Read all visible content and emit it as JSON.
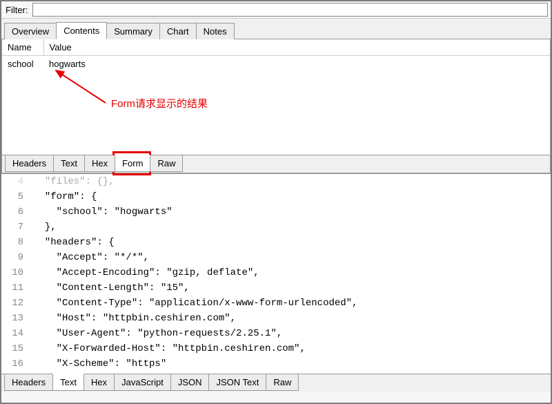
{
  "filter": {
    "label": "Filter:",
    "value": ""
  },
  "mainTabs": [
    "Overview",
    "Contents",
    "Summary",
    "Chart",
    "Notes"
  ],
  "mainActiveIndex": 1,
  "upper": {
    "headers": {
      "name": "Name",
      "value": "Value"
    },
    "rows": [
      {
        "name": "school",
        "value": "hogwarts"
      }
    ],
    "bottomTabs": [
      "Headers",
      "Text",
      "Hex",
      "Form",
      "Raw"
    ],
    "bottomActiveIndex": 3
  },
  "annotation": {
    "text": "Form请求显示的结果"
  },
  "lower": {
    "lines": [
      {
        "n": 4,
        "indent": 1,
        "text": "\"files\": {},",
        "dim": true
      },
      {
        "n": 5,
        "indent": 1,
        "text": "\"form\": {"
      },
      {
        "n": 6,
        "indent": 2,
        "text": "\"school\": \"hogwarts\""
      },
      {
        "n": 7,
        "indent": 1,
        "text": "},"
      },
      {
        "n": 8,
        "indent": 1,
        "text": "\"headers\": {"
      },
      {
        "n": 9,
        "indent": 2,
        "text": "\"Accept\": \"*/*\","
      },
      {
        "n": 10,
        "indent": 2,
        "text": "\"Accept-Encoding\": \"gzip, deflate\","
      },
      {
        "n": 11,
        "indent": 2,
        "text": "\"Content-Length\": \"15\","
      },
      {
        "n": 12,
        "indent": 2,
        "text": "\"Content-Type\": \"application/x-www-form-urlencoded\","
      },
      {
        "n": 13,
        "indent": 2,
        "text": "\"Host\": \"httpbin.ceshiren.com\","
      },
      {
        "n": 14,
        "indent": 2,
        "text": "\"User-Agent\": \"python-requests/2.25.1\","
      },
      {
        "n": 15,
        "indent": 2,
        "text": "\"X-Forwarded-Host\": \"httpbin.ceshiren.com\","
      },
      {
        "n": 16,
        "indent": 2,
        "text": "\"X-Scheme\": \"https\""
      }
    ],
    "bottomTabs": [
      "Headers",
      "Text",
      "Hex",
      "JavaScript",
      "JSON",
      "JSON Text",
      "Raw"
    ],
    "bottomActiveIndex": 1
  }
}
